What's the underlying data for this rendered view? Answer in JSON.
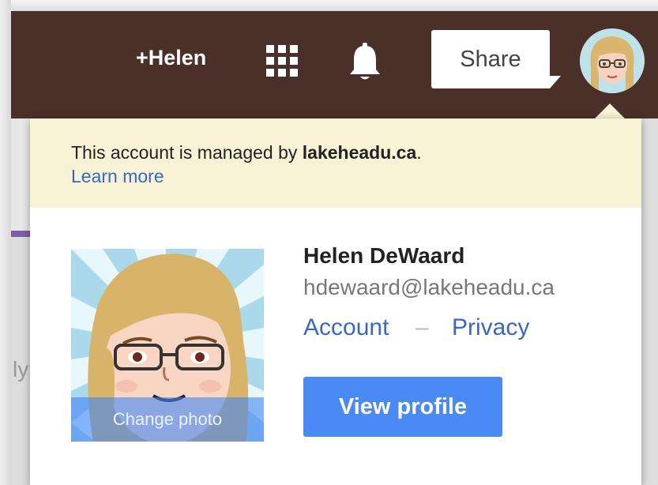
{
  "header": {
    "user_name": "+Helen",
    "share_label": "Share",
    "icons": [
      "apps-grid-icon",
      "notifications-bell-icon"
    ]
  },
  "account_popup": {
    "notice_prefix": "This account is managed by ",
    "notice_domain": "lakeheadu.ca",
    "notice_suffix": ".",
    "learn_more": "Learn more",
    "change_photo": "Change photo",
    "name": "Helen DeWaard",
    "email": "hdewaard@lakeheadu.ca",
    "account_link": "Account",
    "separator": "–",
    "privacy_link": "Privacy",
    "view_profile": "View profile"
  },
  "background": {
    "partial_text": "ly"
  },
  "colors": {
    "topbar": "#4b302a",
    "notice_bg": "#f8f3d6",
    "link": "#3a67c4",
    "primary_button": "#4a8af4"
  }
}
